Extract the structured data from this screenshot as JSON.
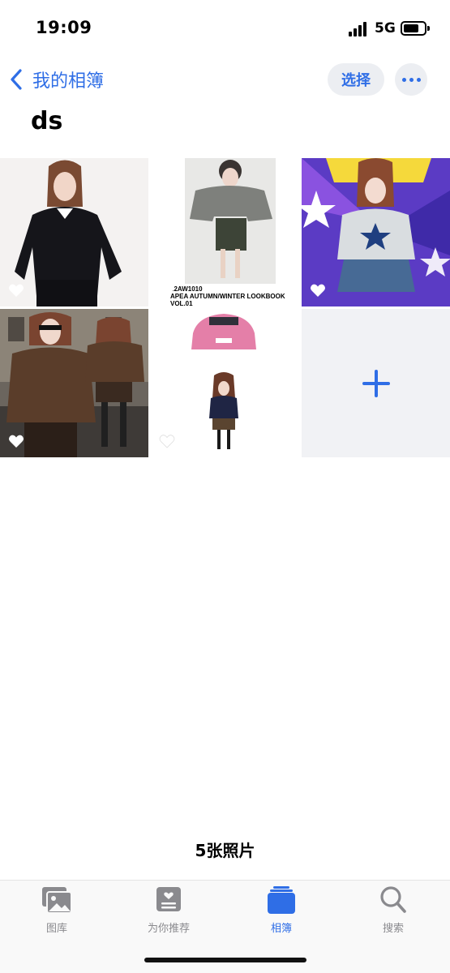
{
  "status_bar": {
    "time": "19:09",
    "network": "5G"
  },
  "nav": {
    "back_label": "我的相簿",
    "select_label": "选择"
  },
  "album": {
    "title": "ds"
  },
  "photos": [
    {
      "caption": ""
    },
    {
      "caption": "22AW1010\nAPEA AUTUMN/WINTER LOOKBOOK\nVOL.01"
    },
    {
      "caption": ""
    },
    {
      "caption": ""
    },
    {
      "caption": ""
    }
  ],
  "footer": {
    "photo_count": "5张照片"
  },
  "tabs": [
    {
      "label": "图库",
      "icon": "photos-icon",
      "active": false
    },
    {
      "label": "为你推荐",
      "icon": "for-you-icon",
      "active": false
    },
    {
      "label": "相簿",
      "icon": "albums-icon",
      "active": true
    },
    {
      "label": "搜索",
      "icon": "search-icon",
      "active": false
    }
  ],
  "colors": {
    "accent": "#2f6ee6",
    "tab_inactive": "#8a8a8e"
  }
}
